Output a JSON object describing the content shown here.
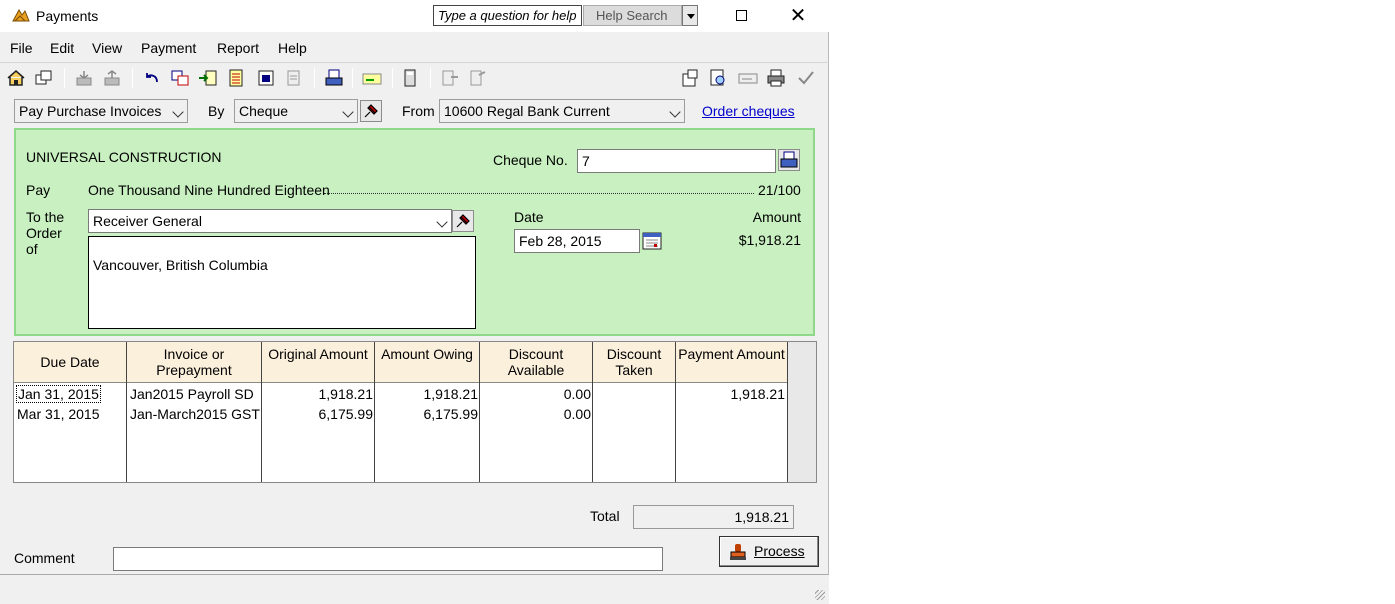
{
  "window": {
    "title": "Payments"
  },
  "help": {
    "placeholder": "Type a question for help",
    "search_label": "Help Search"
  },
  "menu": {
    "file": "File",
    "edit": "Edit",
    "view": "View",
    "payment": "Payment",
    "report": "Report",
    "help": "Help"
  },
  "header": {
    "payment_type": "Pay Purchase Invoices",
    "by_label": "By",
    "method": "Cheque",
    "from_label": "From",
    "account": "10600 Regal Bank Current",
    "order_cheques": "Order cheques"
  },
  "cheque": {
    "company": "UNIVERSAL CONSTRUCTION",
    "cheque_no_label": "Cheque No.",
    "cheque_no": "7",
    "pay_label": "Pay",
    "amount_words": "One Thousand Nine Hundred Eighteen",
    "cents": "21/100",
    "to_order_label": "To the Order of",
    "payee": "Receiver General",
    "address": "Vancouver, British Columbia",
    "date_label": "Date",
    "date": "Feb 28, 2015",
    "amount_label": "Amount",
    "amount": "$1,918.21"
  },
  "table": {
    "headers": [
      "Due Date",
      "Invoice or Prepayment",
      "Original Amount",
      "Amount Owing",
      "Discount Available",
      "Discount Taken",
      "Payment Amount"
    ],
    "rows": [
      {
        "due_date": "Jan 31, 2015",
        "invoice": "Jan2015 Payroll SD",
        "original": "1,918.21",
        "owing": "1,918.21",
        "discount_available": "0.00",
        "discount_taken": "",
        "payment": "1,918.21"
      },
      {
        "due_date": "Mar 31, 2015",
        "invoice": "Jan-March2015 GST",
        "original": "6,175.99",
        "owing": "6,175.99",
        "discount_available": "0.00",
        "discount_taken": "",
        "payment": ""
      }
    ]
  },
  "footer": {
    "total_label": "Total",
    "total": "1,918.21",
    "comment_label": "Comment",
    "comment": "",
    "process_label": "Process"
  }
}
